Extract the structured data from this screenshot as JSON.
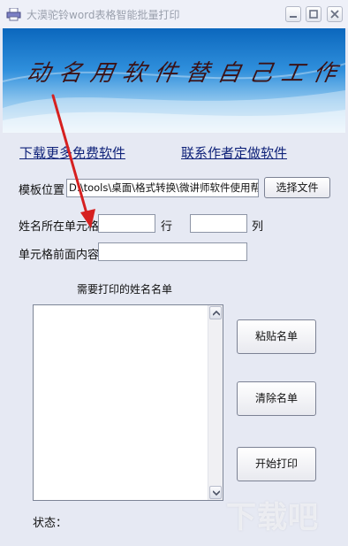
{
  "window": {
    "title": "大漠驼铃word表格智能批量打印",
    "banner_text": "动名用软件替自己工作"
  },
  "links": {
    "download_more": "下载更多免费软件",
    "contact_author": "联系作者定做软件"
  },
  "template": {
    "label": "模板位置",
    "path": "D:\\tools\\桌面\\格式转换\\微讲师软件使用帮",
    "choose_button": "选择文件"
  },
  "name_cell": {
    "label": "姓名所在单元格",
    "row_value": "",
    "row_unit": "行",
    "col_value": "",
    "col_unit": "列"
  },
  "prefix": {
    "label": "单元格前面内容",
    "value": ""
  },
  "name_list": {
    "heading": "需要打印的姓名名单"
  },
  "buttons": {
    "paste": "粘贴名单",
    "clear": "清除名单",
    "print": "开始打印"
  },
  "status": {
    "label": "状态："
  },
  "watermark": "下载吧",
  "colors": {
    "link": "#10237a",
    "annotation_arrow": "#d62020",
    "banner": "#2f8fdc"
  }
}
